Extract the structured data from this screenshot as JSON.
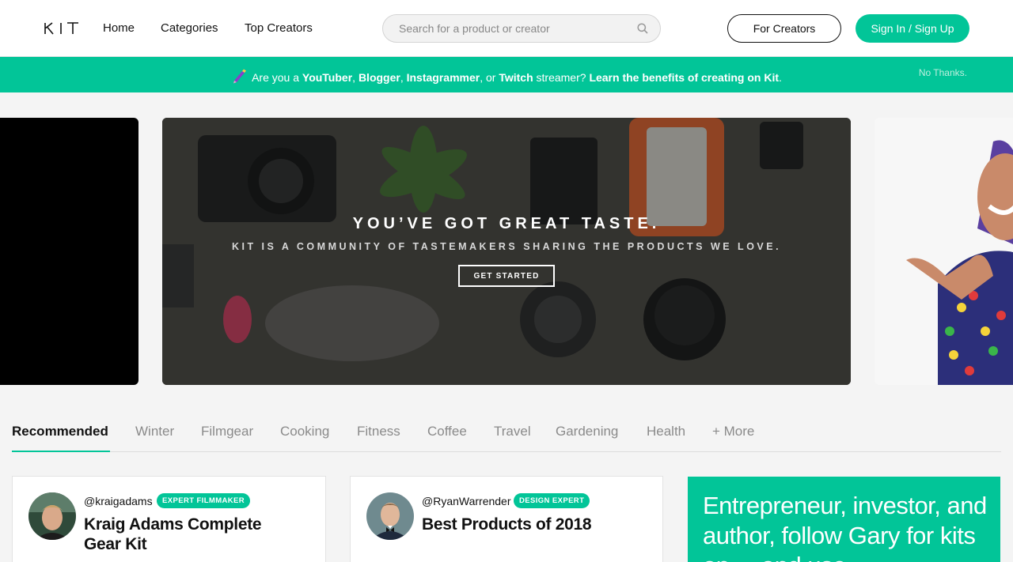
{
  "header": {
    "logo_text": "KIT",
    "nav": [
      "Home",
      "Categories",
      "Top Creators"
    ],
    "search_placeholder": "Search for a product or creator",
    "for_creators_label": "For Creators",
    "sign_in_label": "Sign In / Sign Up"
  },
  "banner": {
    "prefix": "Are you a ",
    "youtuber": "YouTuber",
    "sep1": ", ",
    "blogger": "Blogger",
    "sep2": ", ",
    "instagrammer": "Instagrammer",
    "sep3": ", or ",
    "twitch": "Twitch",
    "mid": " streamer? ",
    "cta": "Learn the benefits of creating on Kit",
    "suffix": ".",
    "dismiss": "No Thanks."
  },
  "hero": {
    "title": "YOU’VE GOT GREAT TASTE.",
    "subtitle": "KIT IS A COMMUNITY OF TASTEMAKERS SHARING THE PRODUCTS WE LOVE.",
    "cta": "GET STARTED"
  },
  "tabs": [
    "Recommended",
    "Winter",
    "Filmgear",
    "Cooking",
    "Fitness",
    "Coffee",
    "Travel",
    "Gardening",
    "Health",
    "+ More"
  ],
  "active_tab": "Recommended",
  "cards": [
    {
      "handle": "@kraigadams",
      "badge": "EXPERT FILMMAKER",
      "title": "Kraig Adams Complete Gear Kit"
    },
    {
      "handle": "@RyanWarrender",
      "badge": "DESIGN EXPERT",
      "title": "Best Products of 2018"
    }
  ],
  "promo": {
    "text": "Entrepreneur, investor, and author, follow Gary for kits on ... and use"
  },
  "colors": {
    "accent": "#02c598",
    "text": "#111111",
    "muted": "#8a8a8a"
  }
}
